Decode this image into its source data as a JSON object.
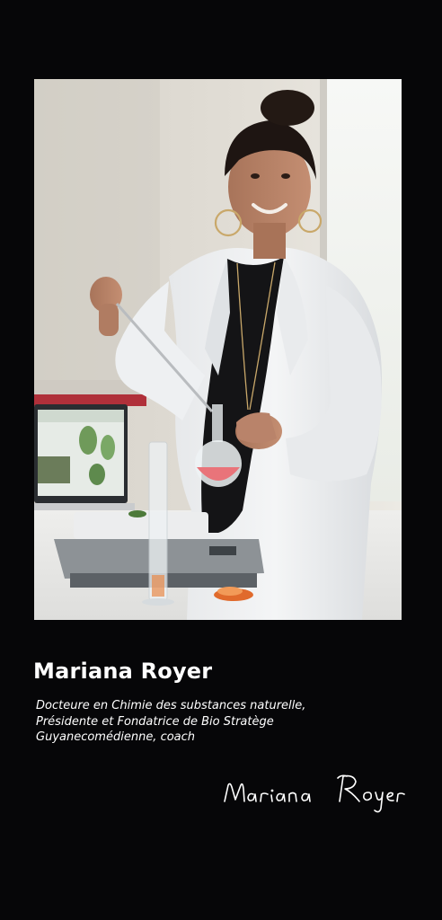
{
  "profile": {
    "name": "Mariana Royer",
    "bio_lines": [
      "Docteure en Chimie des substances naturelle,",
      "Présidente et Fondatrice de Bio Stratège",
      "Guyanecomédienne, coach"
    ],
    "signature_text": "Mariana Royer"
  },
  "colors": {
    "background": "#060608",
    "text": "#ffffff"
  }
}
